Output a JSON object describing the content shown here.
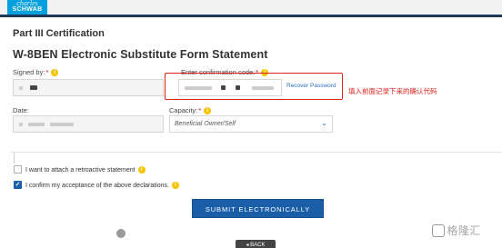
{
  "header": {
    "logo_line1": "charles",
    "logo_line2": "SCHWAB"
  },
  "section": {
    "title": "Part III Certification",
    "form_title": "W-8BEN Electronic Substitute Form Statement"
  },
  "signed_by": {
    "label": "Signed by:",
    "required_mark": "*"
  },
  "confirmation": {
    "label": "Enter confirmation code:",
    "required_mark": "*",
    "recover_link": "Recover Password"
  },
  "annotation": {
    "text": "填入前面记录下来的确认代码"
  },
  "date_field": {
    "label": "Date:"
  },
  "capacity": {
    "label": "Capacity:",
    "required_mark": "*",
    "selected": "Beneficial Owner/Self"
  },
  "checkboxes": [
    {
      "label": "I want to attach a retroactive statement",
      "checked": false
    },
    {
      "label": "I confirm my acceptance of the above declarations.",
      "checked": true
    }
  ],
  "submit": {
    "label": "SUBMIT ELECTRONICALLY"
  },
  "back": {
    "label": "BACK"
  },
  "watermark": {
    "text": "格隆汇"
  },
  "icons": {
    "info": "i",
    "check": "✓",
    "caret": "⌄"
  },
  "colors": {
    "accent": "#1a5ea8",
    "annotation_red": "#e0221b",
    "info_yellow": "#f5c400",
    "logo_blue": "#00a0df"
  }
}
